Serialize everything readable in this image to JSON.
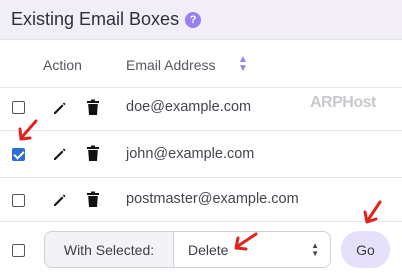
{
  "header": {
    "title": "Existing Email Boxes",
    "help_icon": "?"
  },
  "table": {
    "columns": {
      "action": "Action",
      "email": "Email Address"
    },
    "rows": [
      {
        "email": "doe@example.com",
        "checked": false
      },
      {
        "email": "john@example.com",
        "checked": true
      },
      {
        "email": "postmaster@example.com",
        "checked": false
      }
    ]
  },
  "watermark": "ARPHost",
  "bulk": {
    "label": "With Selected:",
    "selected_option": "Delete",
    "go_label": "Go"
  },
  "colors": {
    "accent": "#9a7ff0",
    "arrow": "#e0231c",
    "checkbox_checked": "#2b6fd6"
  }
}
